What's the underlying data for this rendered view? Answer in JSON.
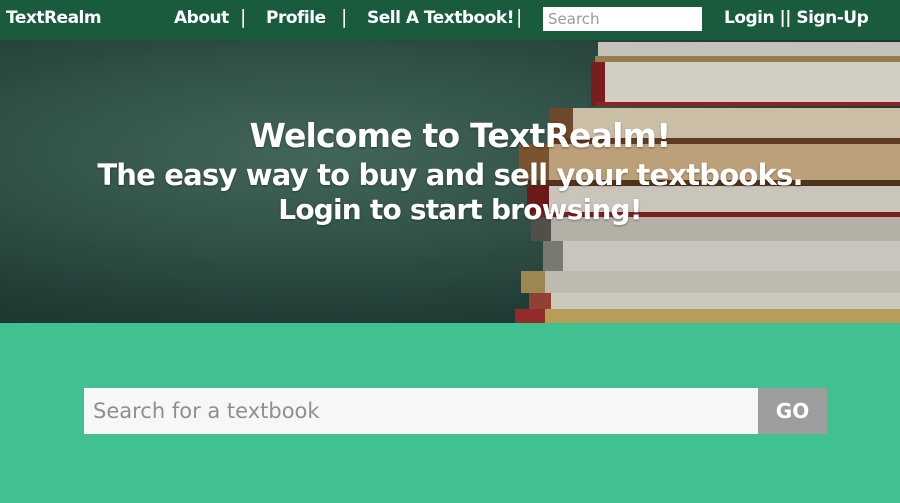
{
  "nav": {
    "brand": "TextRealm",
    "links": [
      "About",
      "Profile",
      "Sell A Textbook!"
    ],
    "separator": "|",
    "search_placeholder": "Search",
    "auth": "Login || Sign-Up"
  },
  "hero": {
    "line1": "Welcome to TextRealm!",
    "line2": "The easy way to buy and sell your textbooks.",
    "line3": "Login to start browsing!"
  },
  "search": {
    "placeholder": "Search for a textbook",
    "button": "GO"
  },
  "colors": {
    "nav_bg": "#1a5b3e",
    "page_bg": "#41c18f",
    "go_button": "#9d9d9d"
  }
}
